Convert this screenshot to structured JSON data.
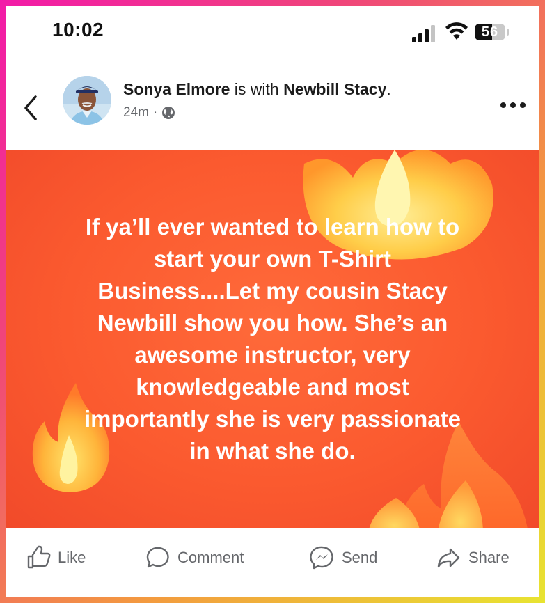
{
  "status_bar": {
    "time": "10:02",
    "battery_level": "56"
  },
  "post": {
    "author": "Sonya Elmore",
    "with_text": "is with",
    "tagged": "Newbill Stacy",
    "period": ".",
    "time_ago": "24m",
    "separator": "·",
    "privacy_icon": "globe-icon",
    "text": "If ya’ll ever wanted to learn how to\nstart your own T-Shirt\nBusiness....Let my cousin Stacy\nNewbill show you how.  She’s an\nawesome instructor, very\nknowledgeable and most\nimportantly she is very passionate\nin what she do.",
    "background_color": "#fb5a2f"
  },
  "actions": {
    "like": "Like",
    "comment": "Comment",
    "send": "Send",
    "share": "Share"
  },
  "icons": {
    "back": "chevron-left-icon",
    "more": "more-horizontal-icon",
    "like": "thumbs-up-icon",
    "comment": "comment-bubble-icon",
    "send": "messenger-icon",
    "share": "share-arrow-icon"
  },
  "colors": {
    "frame_gradient_start": "#f21aa8",
    "frame_gradient_end": "#e8e431",
    "action_text": "#65676b"
  }
}
